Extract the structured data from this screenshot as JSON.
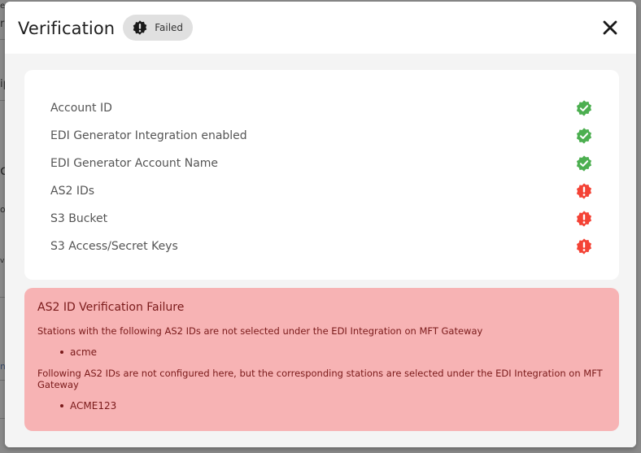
{
  "modal": {
    "title": "Verification",
    "status": {
      "label": "Failed",
      "icon": "exclamation-badge-icon"
    },
    "close_icon": "close-icon"
  },
  "checks": [
    {
      "label": "Account ID",
      "status": "passed",
      "icon": "check-badge-icon"
    },
    {
      "label": "EDI Generator Integration enabled",
      "status": "passed",
      "icon": "check-badge-icon"
    },
    {
      "label": "EDI Generator Account Name",
      "status": "passed",
      "icon": "check-badge-icon"
    },
    {
      "label": "AS2 IDs",
      "status": "failed",
      "icon": "exclamation-badge-icon"
    },
    {
      "label": "S3 Bucket",
      "status": "failed",
      "icon": "exclamation-badge-icon"
    },
    {
      "label": "S3 Access/Secret Keys",
      "status": "failed",
      "icon": "exclamation-badge-icon"
    }
  ],
  "alert": {
    "title": "AS2 ID Verification Failure",
    "sections": [
      {
        "text": "Stations with the following AS2 IDs are not selected under the EDI Integration on MFT Gateway",
        "items": [
          "acme"
        ]
      },
      {
        "text": "Following AS2 IDs are not configured here, but the corresponding stations are selected under the EDI Integration on MFT Gateway",
        "items": [
          "ACME123"
        ]
      }
    ]
  },
  "background_fragments": [
    "e",
    "r",
    "ip",
    "cc",
    "or",
    "va",
    "ne"
  ],
  "colors": {
    "passed": "#4caf50",
    "failed": "#f44336",
    "badge_icon": "#1a1a1a",
    "alert_bg": "#f7b3b4",
    "alert_text": "#7a1a1a"
  }
}
